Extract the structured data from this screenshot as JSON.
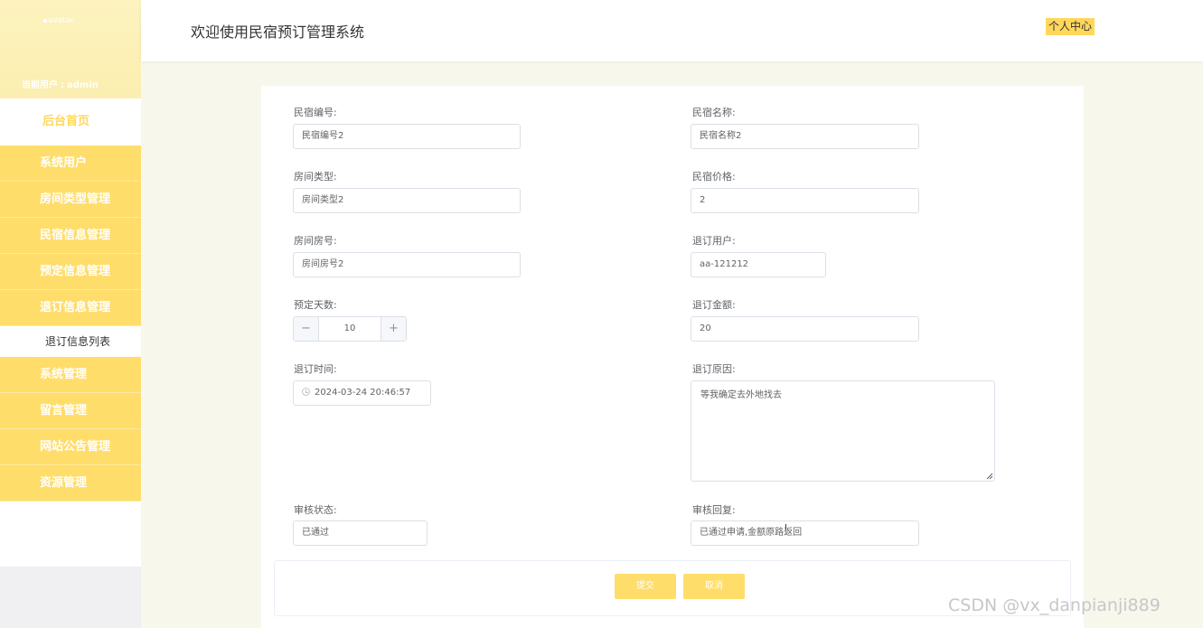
{
  "sidebar": {
    "avatar_alt": "avatar",
    "current_user_label": "当前用户",
    "current_user_value": "admin",
    "home": "后台首页",
    "menu_items": [
      "系统用户",
      "房间类型管理",
      "民宿信息管理",
      "预定信息管理",
      "退订信息管理"
    ],
    "active_submenu": "退订信息列表",
    "menu_items_2": [
      "系统管理",
      "留言管理",
      "网站公告管理",
      "资源管理"
    ]
  },
  "header": {
    "title": "欢迎使用民宿预订管理系统",
    "user_center": "个人中心"
  },
  "form": {
    "homestay_no": {
      "label": "民宿编号:",
      "value": "民宿编号2"
    },
    "homestay_name": {
      "label": "民宿名称:",
      "value": "民宿名称2"
    },
    "room_type": {
      "label": "房间类型:",
      "value": "房间类型2"
    },
    "homestay_price": {
      "label": "民宿价格:",
      "value": "2"
    },
    "room_no": {
      "label": "房间房号:",
      "value": "房间房号2"
    },
    "cancel_user": {
      "label": "退订用户:",
      "value": "aa-121212"
    },
    "booking_days": {
      "label": "预定天数:",
      "value": "10",
      "minus": "−",
      "plus": "+"
    },
    "refund_amount": {
      "label": "退订金额:",
      "value": "20"
    },
    "cancel_time": {
      "label": "退订时间:",
      "value": "2024-03-24 20:46:57"
    },
    "cancel_reason": {
      "label": "退订原因:",
      "value": "等我确定去外地找去"
    },
    "review_status": {
      "label": "审核状态:",
      "value": "已通过"
    },
    "review_reply": {
      "label": "审核回复:",
      "value": "已通过申请,金额原路返回"
    },
    "submit": "提交",
    "cancel": "取消"
  },
  "watermark": "CSDN @vx_danpianji889"
}
